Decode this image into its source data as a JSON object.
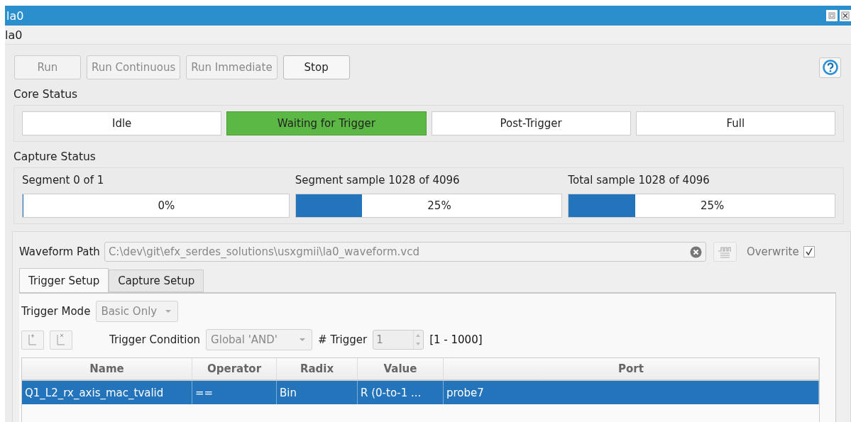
{
  "window": {
    "title": "la0"
  },
  "subtitle": "la0",
  "toolbar": {
    "buttons": [
      {
        "label": "Run",
        "disabled": true
      },
      {
        "label": "Run Continuous",
        "disabled": true
      },
      {
        "label": "Run Immediate",
        "disabled": true
      },
      {
        "label": "Stop",
        "disabled": false
      }
    ]
  },
  "core_status": {
    "label": "Core Status",
    "states": [
      {
        "label": "Idle",
        "selected": false
      },
      {
        "label": "Waiting for Trigger",
        "selected": true
      },
      {
        "label": "Post-Trigger",
        "selected": false
      },
      {
        "label": "Full",
        "selected": false
      }
    ]
  },
  "capture_status": {
    "label": "Capture Status",
    "bars": [
      {
        "caption": "Segment 0 of 1",
        "reading": "0%",
        "level": 0
      },
      {
        "caption": "Segment sample 1028 of 4096",
        "reading": "25%",
        "level": 0.25
      },
      {
        "caption": "Total sample 1028 of 4096",
        "reading": "25%",
        "level": 0.25
      }
    ]
  },
  "waveform_path": {
    "label": "Waveform Path",
    "value": "C:\\dev\\git\\efx_serdes_solutions\\usxgmii\\la0_waveform.vcd",
    "overwrite_label": "Overwrite",
    "overwrite": true
  },
  "tabs": [
    {
      "label": "Trigger Setup",
      "selected": true
    },
    {
      "label": "Capture Setup",
      "selected": false
    }
  ],
  "trigger_mode": {
    "label": "Trigger Mode",
    "value": "Basic Only"
  },
  "trigger_condition": {
    "label": "Trigger Condition",
    "value": "Global 'AND'"
  },
  "trigger_count": {
    "label": "# Trigger",
    "value": "1",
    "range": "[1 - 1000]"
  },
  "table": {
    "columns": [
      "Name",
      "Operator",
      "Radix",
      "Value",
      "Port"
    ],
    "rows": [
      {
        "selected": true,
        "cells": [
          "Q1_L2_rx_axis_mac_tvalid",
          "==",
          "Bin",
          "R (0-to-1 ...",
          "probe7"
        ]
      }
    ]
  }
}
